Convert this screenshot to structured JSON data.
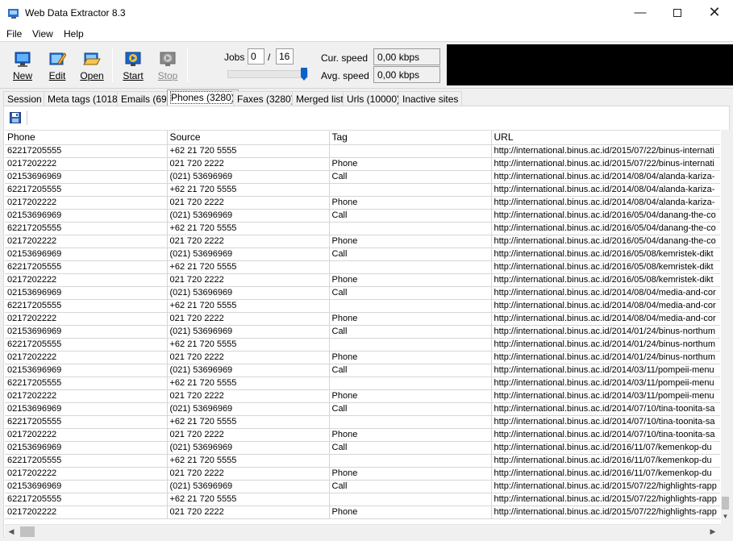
{
  "window": {
    "title": "Web Data Extractor 8.3"
  },
  "menu": [
    "File",
    "View",
    "Help"
  ],
  "toolbar": {
    "buttons": [
      {
        "label": "New",
        "icon": "new-session-icon"
      },
      {
        "label": "Edit",
        "icon": "edit-icon"
      },
      {
        "label": "Open",
        "icon": "open-folder-icon"
      },
      {
        "label": "Start",
        "icon": "start-icon"
      },
      {
        "label": "Stop",
        "icon": "stop-icon",
        "disabled": true
      }
    ],
    "jobs_label": "Jobs",
    "jobs_current": "0",
    "jobs_separator": "/",
    "jobs_total": "16",
    "jobs_slider_fraction": 1.0,
    "cur_speed_label": "Cur. speed",
    "cur_speed_value": "0,00 kbps",
    "avg_speed_label": "Avg. speed",
    "avg_speed_value": "0,00 kbps"
  },
  "tabs": [
    {
      "label": "Session"
    },
    {
      "label": "Meta tags (1018)"
    },
    {
      "label": "Emails (69)"
    },
    {
      "label": "Phones (3280)",
      "active": true
    },
    {
      "label": "Faxes (3280)"
    },
    {
      "label": "Merged list"
    },
    {
      "label": "Urls (10000)"
    },
    {
      "label": "Inactive sites"
    }
  ],
  "table": {
    "columns": [
      "Phone",
      "Source",
      "Tag",
      "URL"
    ],
    "rows": [
      [
        "62217205555",
        "+62 21 720 5555",
        "",
        "http://international.binus.ac.id/2015/07/22/binus-internati"
      ],
      [
        "0217202222",
        "021 720 2222",
        "Phone",
        "http://international.binus.ac.id/2015/07/22/binus-internati"
      ],
      [
        "02153696969",
        "(021) 53696969",
        "Call",
        "http://international.binus.ac.id/2014/08/04/alanda-kariza-"
      ],
      [
        "62217205555",
        "+62 21 720 5555",
        "",
        "http://international.binus.ac.id/2014/08/04/alanda-kariza-"
      ],
      [
        "0217202222",
        "021 720 2222",
        "Phone",
        "http://international.binus.ac.id/2014/08/04/alanda-kariza-"
      ],
      [
        "02153696969",
        "(021) 53696969",
        "Call",
        "http://international.binus.ac.id/2016/05/04/danang-the-co"
      ],
      [
        "62217205555",
        "+62 21 720 5555",
        "",
        "http://international.binus.ac.id/2016/05/04/danang-the-co"
      ],
      [
        "0217202222",
        "021 720 2222",
        "Phone",
        "http://international.binus.ac.id/2016/05/04/danang-the-co"
      ],
      [
        "02153696969",
        "(021) 53696969",
        "Call",
        "http://international.binus.ac.id/2016/05/08/kemristek-dikt"
      ],
      [
        "62217205555",
        "+62 21 720 5555",
        "",
        "http://international.binus.ac.id/2016/05/08/kemristek-dikt"
      ],
      [
        "0217202222",
        "021 720 2222",
        "Phone",
        "http://international.binus.ac.id/2016/05/08/kemristek-dikt"
      ],
      [
        "02153696969",
        "(021) 53696969",
        "Call",
        "http://international.binus.ac.id/2014/08/04/media-and-cor"
      ],
      [
        "62217205555",
        "+62 21 720 5555",
        "",
        "http://international.binus.ac.id/2014/08/04/media-and-cor"
      ],
      [
        "0217202222",
        "021 720 2222",
        "Phone",
        "http://international.binus.ac.id/2014/08/04/media-and-cor"
      ],
      [
        "02153696969",
        "(021) 53696969",
        "Call",
        "http://international.binus.ac.id/2014/01/24/binus-northum"
      ],
      [
        "62217205555",
        "+62 21 720 5555",
        "",
        "http://international.binus.ac.id/2014/01/24/binus-northum"
      ],
      [
        "0217202222",
        "021 720 2222",
        "Phone",
        "http://international.binus.ac.id/2014/01/24/binus-northum"
      ],
      [
        "02153696969",
        "(021) 53696969",
        "Call",
        "http://international.binus.ac.id/2014/03/11/pompeii-menu"
      ],
      [
        "62217205555",
        "+62 21 720 5555",
        "",
        "http://international.binus.ac.id/2014/03/11/pompeii-menu"
      ],
      [
        "0217202222",
        "021 720 2222",
        "Phone",
        "http://international.binus.ac.id/2014/03/11/pompeii-menu"
      ],
      [
        "02153696969",
        "(021) 53696969",
        "Call",
        "http://international.binus.ac.id/2014/07/10/tina-toonita-sa"
      ],
      [
        "62217205555",
        "+62 21 720 5555",
        "",
        "http://international.binus.ac.id/2014/07/10/tina-toonita-sa"
      ],
      [
        "0217202222",
        "021 720 2222",
        "Phone",
        "http://international.binus.ac.id/2014/07/10/tina-toonita-sa"
      ],
      [
        "02153696969",
        "(021) 53696969",
        "Call",
        "http://international.binus.ac.id/2016/11/07/kemenkop-du"
      ],
      [
        "62217205555",
        "+62 21 720 5555",
        "",
        "http://international.binus.ac.id/2016/11/07/kemenkop-du"
      ],
      [
        "0217202222",
        "021 720 2222",
        "Phone",
        "http://international.binus.ac.id/2016/11/07/kemenkop-du"
      ],
      [
        "02153696969",
        "(021) 53696969",
        "Call",
        "http://international.binus.ac.id/2015/07/22/highlights-rapp"
      ],
      [
        "62217205555",
        "+62 21 720 5555",
        "",
        "http://international.binus.ac.id/2015/07/22/highlights-rapp"
      ],
      [
        "0217202222",
        "021 720 2222",
        "Phone",
        "http://international.binus.ac.id/2015/07/22/highlights-rapp"
      ]
    ]
  }
}
